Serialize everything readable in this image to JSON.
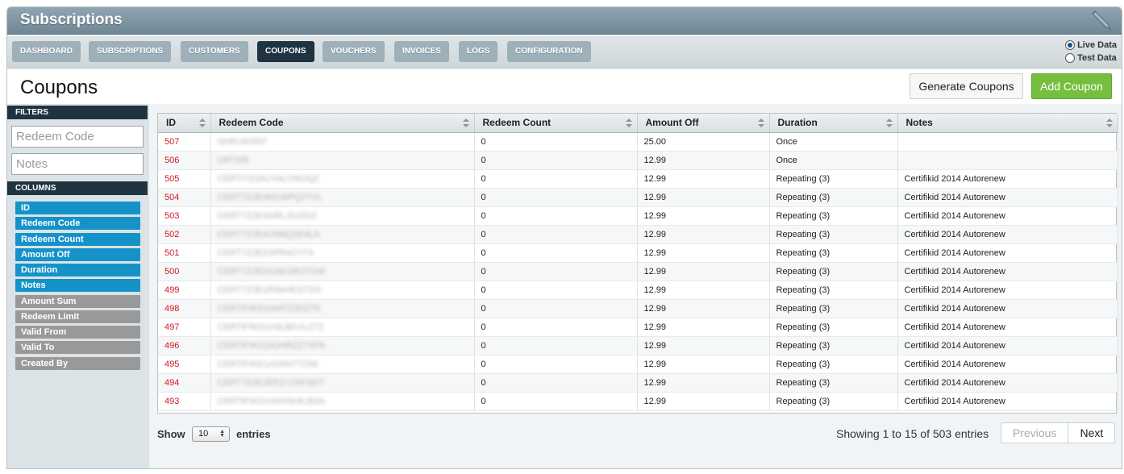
{
  "app": {
    "title": "Subscriptions"
  },
  "nav": {
    "tabs": [
      {
        "label": "DASHBOARD"
      },
      {
        "label": "SUBSCRIPTIONS"
      },
      {
        "label": "CUSTOMERS"
      },
      {
        "label": "COUPONS",
        "active": true
      },
      {
        "label": "VOUCHERS"
      },
      {
        "label": "INVOICES"
      },
      {
        "label": "LOGS"
      },
      {
        "label": "CONFIGURATION"
      }
    ],
    "data_mode": {
      "live_label": "Live Data",
      "test_label": "Test Data",
      "selected": "Live Data"
    }
  },
  "page": {
    "title": "Coupons",
    "generate_label": "Generate Coupons",
    "add_label": "Add Coupon"
  },
  "sidebar": {
    "filters_label": "FILTERS",
    "redeem_code_placeholder": "Redeem Code",
    "notes_placeholder": "Notes",
    "columns_label": "COLUMNS",
    "columns": [
      {
        "label": "ID",
        "on": true
      },
      {
        "label": "Redeem Code",
        "on": true
      },
      {
        "label": "Redeem Count",
        "on": true
      },
      {
        "label": "Amount Off",
        "on": true
      },
      {
        "label": "Duration",
        "on": true
      },
      {
        "label": "Notes",
        "on": true
      },
      {
        "label": "Amount Sum",
        "on": false
      },
      {
        "label": "Redeem Limit",
        "on": false
      },
      {
        "label": "Valid From",
        "on": false
      },
      {
        "label": "Valid To",
        "on": false
      },
      {
        "label": "Created By",
        "on": false
      }
    ]
  },
  "table": {
    "headers": [
      "ID",
      "Redeem Code",
      "Redeem Count",
      "Amount Off",
      "Duration",
      "Notes"
    ],
    "rows": [
      {
        "id": "507",
        "code": "GHEU82937",
        "count": "0",
        "amount": "25.00",
        "duration": "Once",
        "notes": ""
      },
      {
        "id": "506",
        "code": "U8T295",
        "count": "0",
        "amount": "12.99",
        "duration": "Once",
        "notes": ""
      },
      {
        "id": "505",
        "code": "CERTI7Z2AUYALYMOQZ",
        "count": "0",
        "amount": "12.99",
        "duration": "Repeating (3)",
        "notes": "Certifikid 2014 Autorenew"
      },
      {
        "id": "504",
        "code": "CERT7Z2E4M1WPQ2TVL",
        "count": "0",
        "amount": "12.99",
        "duration": "Repeating (3)",
        "notes": "Certifikid 2014 Autorenew"
      },
      {
        "id": "503",
        "code": "CERT7Z2E3GRLJ2J2GZ",
        "count": "0",
        "amount": "12.99",
        "duration": "Repeating (3)",
        "notes": "Certifikid 2014 Autorenew"
      },
      {
        "id": "502",
        "code": "CERT7Z2E4UM8Q2E4LA",
        "count": "0",
        "amount": "12.99",
        "duration": "Repeating (3)",
        "notes": "Certifikid 2014 Autorenew"
      },
      {
        "id": "501",
        "code": "CERT7Z2EZSPR4ZYTS",
        "count": "0",
        "amount": "12.99",
        "duration": "Repeating (3)",
        "notes": "Certifikid 2014 Autorenew"
      },
      {
        "id": "500",
        "code": "CERT7Z2E2GAEGR2TOW",
        "count": "0",
        "amount": "12.99",
        "duration": "Repeating (3)",
        "notes": "Certifikid 2014 Autorenew"
      },
      {
        "id": "499",
        "code": "CERT7Z2E1R9AHEGT2G",
        "count": "0",
        "amount": "12.99",
        "duration": "Repeating (3)",
        "notes": "Certifikid 2014 Autorenew"
      },
      {
        "id": "498",
        "code": "CERTIFIKD1AMTZ3DZ7S",
        "count": "0",
        "amount": "12.99",
        "duration": "Repeating (3)",
        "notes": "Certifikid 2014 Autorenew"
      },
      {
        "id": "497",
        "code": "CERTIFIKD1H3LBKVLZ7Z",
        "count": "0",
        "amount": "12.99",
        "duration": "Repeating (3)",
        "notes": "Certifikid 2014 Autorenew"
      },
      {
        "id": "496",
        "code": "CERTIFIKD1A2HRZZ7SFA",
        "count": "0",
        "amount": "12.99",
        "duration": "Repeating (3)",
        "notes": "Certifikid 2014 Autorenew"
      },
      {
        "id": "495",
        "code": "CERTIFIKD1A2ANT7Z5K",
        "count": "0",
        "amount": "12.99",
        "duration": "Repeating (3)",
        "notes": "Certifikid 2014 Autorenew"
      },
      {
        "id": "494",
        "code": "CERT7Z2E2EPZY2SFSET",
        "count": "0",
        "amount": "12.99",
        "duration": "Repeating (3)",
        "notes": "Certifikid 2014 Autorenew"
      },
      {
        "id": "493",
        "code": "CERTIFIKD1H2HSHKJ83A",
        "count": "0",
        "amount": "12.99",
        "duration": "Repeating (3)",
        "notes": "Certifikid 2014 Autorenew"
      }
    ]
  },
  "footer": {
    "show_label": "Show",
    "page_size": "10",
    "entries_label": "entries",
    "showing_text": "Showing 1 to 15 of 503 entries",
    "previous_label": "Previous",
    "next_label": "Next"
  },
  "colors": {
    "nav_active": "#1f3340",
    "nav_tab": "#9eb0ba",
    "column_on": "#1593c9",
    "column_off": "#999999",
    "add_button": "#76bf3e",
    "id_link": "#d0181f"
  }
}
